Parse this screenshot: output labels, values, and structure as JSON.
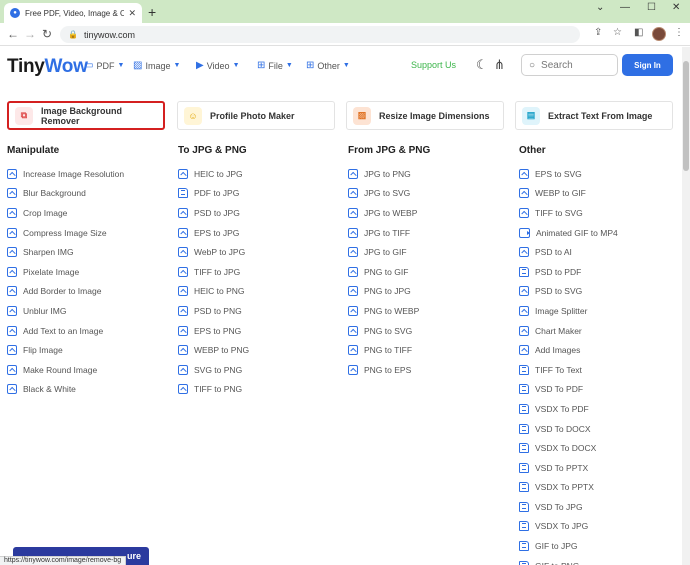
{
  "browser": {
    "tab_title": "Free PDF, Video, Image & Other",
    "url": "tinywow.com",
    "status_url": "https://tinywow.com/image/remove-bg"
  },
  "header": {
    "logo_tiny": "Tiny",
    "logo_wow": "Wow",
    "menu": [
      {
        "label": "PDF"
      },
      {
        "label": "Image"
      },
      {
        "label": "Video"
      },
      {
        "label": "File"
      },
      {
        "label": "Other"
      }
    ],
    "support": "Support Us",
    "search_placeholder": "Search",
    "signin": "Sign In"
  },
  "featured": [
    {
      "label": "Image Background Remover",
      "icon": "background-remove-icon"
    },
    {
      "label": "Profile Photo Maker",
      "icon": "profile-icon"
    },
    {
      "label": "Resize Image Dimensions",
      "icon": "resize-icon"
    },
    {
      "label": "Extract Text From Image",
      "icon": "text-extract-icon"
    }
  ],
  "columns": [
    {
      "title": "Manipulate",
      "items": [
        "Increase Image Resolution",
        "Blur Background",
        "Crop Image",
        "Compress Image Size",
        "Sharpen IMG",
        "Pixelate Image",
        "Add Border to Image",
        "Unblur IMG",
        "Add Text to an Image",
        "Flip Image",
        "Make Round Image",
        "Black & White"
      ]
    },
    {
      "title": "To JPG & PNG",
      "items": [
        "HEIC to JPG",
        "PDF to JPG",
        "PSD to JPG",
        "EPS to JPG",
        "WebP to JPG",
        "TIFF to JPG",
        "HEIC to PNG",
        "PSD to PNG",
        "EPS to PNG",
        "WEBP to PNG",
        "SVG to PNG",
        "TIFF to PNG"
      ]
    },
    {
      "title": "From JPG & PNG",
      "items": [
        "JPG to PNG",
        "JPG to SVG",
        "JPG to WEBP",
        "JPG to TIFF",
        "JPG to GIF",
        "PNG to GIF",
        "PNG to JPG",
        "PNG to WEBP",
        "PNG to SVG",
        "PNG to TIFF",
        "PNG to EPS"
      ]
    },
    {
      "title": "Other",
      "items": [
        "EPS to SVG",
        "WEBP to GIF",
        "TIFF to SVG",
        "Animated GIF to MP4",
        "PSD to AI",
        "PSD to PDF",
        "PSD to SVG",
        "Image Splitter",
        "Chart Maker",
        "Add Images",
        "TIFF To Text",
        "VSD To PDF",
        "VSDX To PDF",
        "VSD To DOCX",
        "VSDX To DOCX",
        "VSD To PPTX",
        "VSDX To PPTX",
        "VSD To JPG",
        "VSDX To JPG",
        "GIF to JPG",
        "GIF to PNG"
      ]
    }
  ],
  "bottom": {
    "feature_button": "ure"
  },
  "colors": {
    "accent": "#2f6fe4",
    "support": "#3bb54a",
    "highlight": "#d42020"
  }
}
